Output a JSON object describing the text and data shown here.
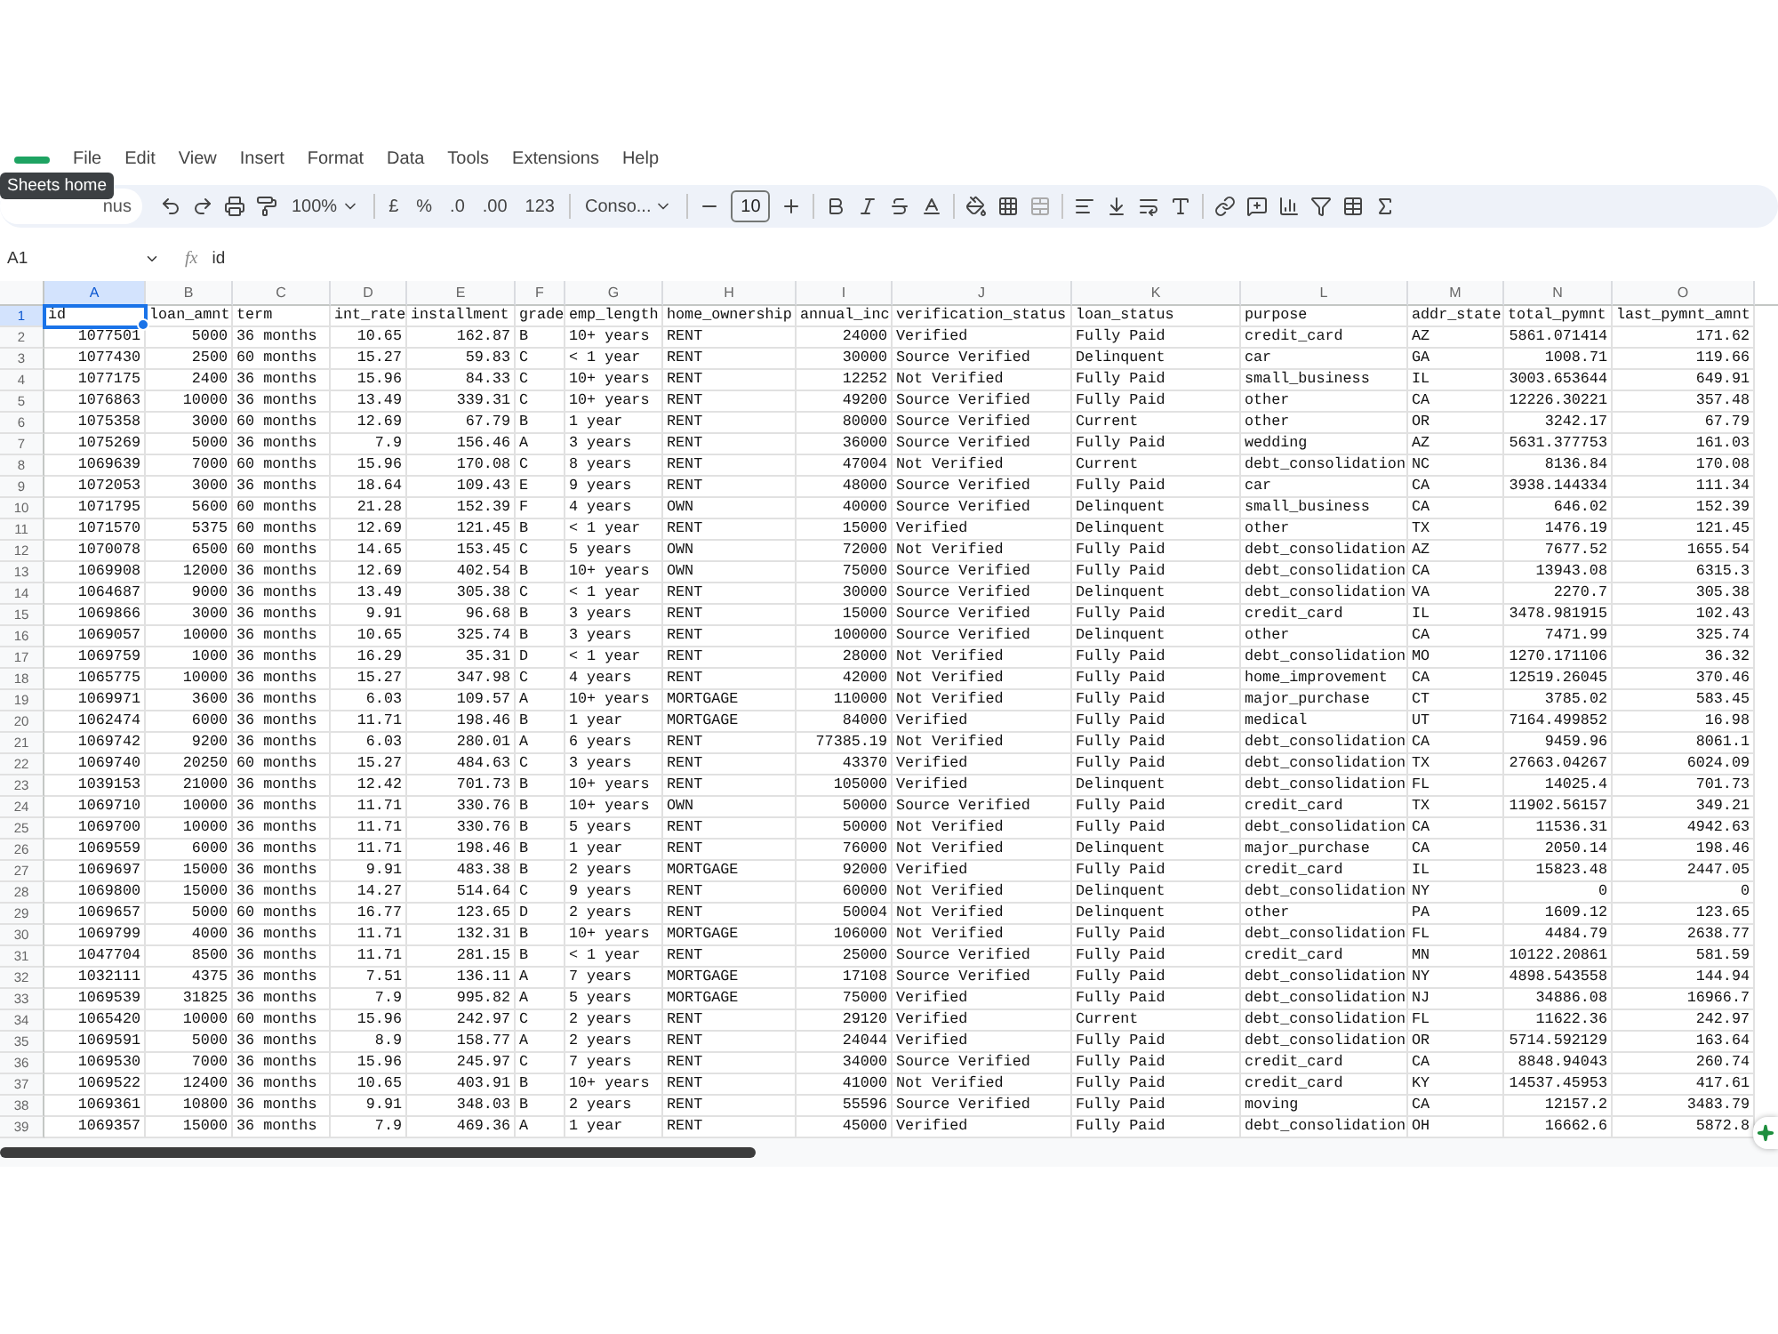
{
  "menu": [
    "File",
    "Edit",
    "View",
    "Insert",
    "Format",
    "Data",
    "Tools",
    "Extensions",
    "Help"
  ],
  "search": {
    "text": "nus"
  },
  "tooltip": "Sheets home",
  "toolbar": {
    "zoom": "100%",
    "currency": "£",
    "percent": "%",
    "decrease_decimals": ".0",
    "increase_decimals": ".00",
    "number_format": "123",
    "font": "Conso...",
    "font_size": "10"
  },
  "name_box": "A1",
  "formula_label": "fx",
  "formula": "id",
  "columns": [
    {
      "letter": "A",
      "numeric": true,
      "selected": true
    },
    {
      "letter": "B",
      "numeric": true,
      "selected": false
    },
    {
      "letter": "C",
      "numeric": false,
      "selected": false
    },
    {
      "letter": "D",
      "numeric": true,
      "selected": false
    },
    {
      "letter": "E",
      "numeric": true,
      "selected": false
    },
    {
      "letter": "F",
      "numeric": false,
      "selected": false
    },
    {
      "letter": "G",
      "numeric": false,
      "selected": false
    },
    {
      "letter": "H",
      "numeric": false,
      "selected": false
    },
    {
      "letter": "I",
      "numeric": true,
      "selected": false
    },
    {
      "letter": "J",
      "numeric": false,
      "selected": false
    },
    {
      "letter": "K",
      "numeric": false,
      "selected": false
    },
    {
      "letter": "L",
      "numeric": false,
      "selected": false
    },
    {
      "letter": "M",
      "numeric": false,
      "selected": false
    },
    {
      "letter": "N",
      "numeric": true,
      "selected": false
    },
    {
      "letter": "O",
      "numeric": true,
      "selected": false
    }
  ],
  "rows": [
    {
      "number": "1",
      "kind": "header",
      "selected": true,
      "cells": [
        "id",
        "loan_amnt",
        "term",
        "int_rate",
        "installment",
        "grade",
        "emp_length",
        "home_ownership",
        "annual_inc",
        "verification_status",
        "loan_status",
        "purpose",
        "addr_state",
        "total_pymnt",
        "last_pymnt_amnt"
      ]
    },
    {
      "number": "2",
      "kind": "data",
      "selected": false,
      "cells": [
        "1077501",
        "5000",
        "36 months",
        "10.65",
        "162.87",
        "B",
        "10+ years",
        "RENT",
        "24000",
        "Verified",
        "Fully Paid",
        "credit_card",
        "AZ",
        "5861.071414",
        "171.62"
      ]
    },
    {
      "number": "3",
      "kind": "data",
      "selected": false,
      "cells": [
        "1077430",
        "2500",
        "60 months",
        "15.27",
        "59.83",
        "C",
        "< 1 year",
        "RENT",
        "30000",
        "Source Verified",
        "Delinquent",
        "car",
        "GA",
        "1008.71",
        "119.66"
      ]
    },
    {
      "number": "4",
      "kind": "data",
      "selected": false,
      "cells": [
        "1077175",
        "2400",
        "36 months",
        "15.96",
        "84.33",
        "C",
        "10+ years",
        "RENT",
        "12252",
        "Not Verified",
        "Fully Paid",
        "small_business",
        "IL",
        "3003.653644",
        "649.91"
      ]
    },
    {
      "number": "5",
      "kind": "data",
      "selected": false,
      "cells": [
        "1076863",
        "10000",
        "36 months",
        "13.49",
        "339.31",
        "C",
        "10+ years",
        "RENT",
        "49200",
        "Source Verified",
        "Fully Paid",
        "other",
        "CA",
        "12226.30221",
        "357.48"
      ]
    },
    {
      "number": "6",
      "kind": "data",
      "selected": false,
      "cells": [
        "1075358",
        "3000",
        "60 months",
        "12.69",
        "67.79",
        "B",
        "1 year",
        "RENT",
        "80000",
        "Source Verified",
        "Current",
        "other",
        "OR",
        "3242.17",
        "67.79"
      ]
    },
    {
      "number": "7",
      "kind": "data",
      "selected": false,
      "cells": [
        "1075269",
        "5000",
        "36 months",
        "7.9",
        "156.46",
        "A",
        "3 years",
        "RENT",
        "36000",
        "Source Verified",
        "Fully Paid",
        "wedding",
        "AZ",
        "5631.377753",
        "161.03"
      ]
    },
    {
      "number": "8",
      "kind": "data",
      "selected": false,
      "cells": [
        "1069639",
        "7000",
        "60 months",
        "15.96",
        "170.08",
        "C",
        "8 years",
        "RENT",
        "47004",
        "Not Verified",
        "Current",
        "debt_consolidation",
        "NC",
        "8136.84",
        "170.08"
      ]
    },
    {
      "number": "9",
      "kind": "data",
      "selected": false,
      "cells": [
        "1072053",
        "3000",
        "36 months",
        "18.64",
        "109.43",
        "E",
        "9 years",
        "RENT",
        "48000",
        "Source Verified",
        "Fully Paid",
        "car",
        "CA",
        "3938.144334",
        "111.34"
      ]
    },
    {
      "number": "10",
      "kind": "data",
      "selected": false,
      "cells": [
        "1071795",
        "5600",
        "60 months",
        "21.28",
        "152.39",
        "F",
        "4 years",
        "OWN",
        "40000",
        "Source Verified",
        "Delinquent",
        "small_business",
        "CA",
        "646.02",
        "152.39"
      ]
    },
    {
      "number": "11",
      "kind": "data",
      "selected": false,
      "cells": [
        "1071570",
        "5375",
        "60 months",
        "12.69",
        "121.45",
        "B",
        "< 1 year",
        "RENT",
        "15000",
        "Verified",
        "Delinquent",
        "other",
        "TX",
        "1476.19",
        "121.45"
      ]
    },
    {
      "number": "12",
      "kind": "data",
      "selected": false,
      "cells": [
        "1070078",
        "6500",
        "60 months",
        "14.65",
        "153.45",
        "C",
        "5 years",
        "OWN",
        "72000",
        "Not Verified",
        "Fully Paid",
        "debt_consolidation",
        "AZ",
        "7677.52",
        "1655.54"
      ]
    },
    {
      "number": "13",
      "kind": "data",
      "selected": false,
      "cells": [
        "1069908",
        "12000",
        "36 months",
        "12.69",
        "402.54",
        "B",
        "10+ years",
        "OWN",
        "75000",
        "Source Verified",
        "Fully Paid",
        "debt_consolidation",
        "CA",
        "13943.08",
        "6315.3"
      ]
    },
    {
      "number": "14",
      "kind": "data",
      "selected": false,
      "cells": [
        "1064687",
        "9000",
        "36 months",
        "13.49",
        "305.38",
        "C",
        "< 1 year",
        "RENT",
        "30000",
        "Source Verified",
        "Delinquent",
        "debt_consolidation",
        "VA",
        "2270.7",
        "305.38"
      ]
    },
    {
      "number": "15",
      "kind": "data",
      "selected": false,
      "cells": [
        "1069866",
        "3000",
        "36 months",
        "9.91",
        "96.68",
        "B",
        "3 years",
        "RENT",
        "15000",
        "Source Verified",
        "Fully Paid",
        "credit_card",
        "IL",
        "3478.981915",
        "102.43"
      ]
    },
    {
      "number": "16",
      "kind": "data",
      "selected": false,
      "cells": [
        "1069057",
        "10000",
        "36 months",
        "10.65",
        "325.74",
        "B",
        "3 years",
        "RENT",
        "100000",
        "Source Verified",
        "Delinquent",
        "other",
        "CA",
        "7471.99",
        "325.74"
      ]
    },
    {
      "number": "17",
      "kind": "data",
      "selected": false,
      "cells": [
        "1069759",
        "1000",
        "36 months",
        "16.29",
        "35.31",
        "D",
        "< 1 year",
        "RENT",
        "28000",
        "Not Verified",
        "Fully Paid",
        "debt_consolidation",
        "MO",
        "1270.171106",
        "36.32"
      ]
    },
    {
      "number": "18",
      "kind": "data",
      "selected": false,
      "cells": [
        "1065775",
        "10000",
        "36 months",
        "15.27",
        "347.98",
        "C",
        "4 years",
        "RENT",
        "42000",
        "Not Verified",
        "Fully Paid",
        "home_improvement",
        "CA",
        "12519.26045",
        "370.46"
      ]
    },
    {
      "number": "19",
      "kind": "data",
      "selected": false,
      "cells": [
        "1069971",
        "3600",
        "36 months",
        "6.03",
        "109.57",
        "A",
        "10+ years",
        "MORTGAGE",
        "110000",
        "Not Verified",
        "Fully Paid",
        "major_purchase",
        "CT",
        "3785.02",
        "583.45"
      ]
    },
    {
      "number": "20",
      "kind": "data",
      "selected": false,
      "cells": [
        "1062474",
        "6000",
        "36 months",
        "11.71",
        "198.46",
        "B",
        "1 year",
        "MORTGAGE",
        "84000",
        "Verified",
        "Fully Paid",
        "medical",
        "UT",
        "7164.499852",
        "16.98"
      ]
    },
    {
      "number": "21",
      "kind": "data",
      "selected": false,
      "cells": [
        "1069742",
        "9200",
        "36 months",
        "6.03",
        "280.01",
        "A",
        "6 years",
        "RENT",
        "77385.19",
        "Not Verified",
        "Fully Paid",
        "debt_consolidation",
        "CA",
        "9459.96",
        "8061.1"
      ]
    },
    {
      "number": "22",
      "kind": "data",
      "selected": false,
      "cells": [
        "1069740",
        "20250",
        "60 months",
        "15.27",
        "484.63",
        "C",
        "3 years",
        "RENT",
        "43370",
        "Verified",
        "Fully Paid",
        "debt_consolidation",
        "TX",
        "27663.04267",
        "6024.09"
      ]
    },
    {
      "number": "23",
      "kind": "data",
      "selected": false,
      "cells": [
        "1039153",
        "21000",
        "36 months",
        "12.42",
        "701.73",
        "B",
        "10+ years",
        "RENT",
        "105000",
        "Verified",
        "Delinquent",
        "debt_consolidation",
        "FL",
        "14025.4",
        "701.73"
      ]
    },
    {
      "number": "24",
      "kind": "data",
      "selected": false,
      "cells": [
        "1069710",
        "10000",
        "36 months",
        "11.71",
        "330.76",
        "B",
        "10+ years",
        "OWN",
        "50000",
        "Source Verified",
        "Fully Paid",
        "credit_card",
        "TX",
        "11902.56157",
        "349.21"
      ]
    },
    {
      "number": "25",
      "kind": "data",
      "selected": false,
      "cells": [
        "1069700",
        "10000",
        "36 months",
        "11.71",
        "330.76",
        "B",
        "5 years",
        "RENT",
        "50000",
        "Not Verified",
        "Fully Paid",
        "debt_consolidation",
        "CA",
        "11536.31",
        "4942.63"
      ]
    },
    {
      "number": "26",
      "kind": "data",
      "selected": false,
      "cells": [
        "1069559",
        "6000",
        "36 months",
        "11.71",
        "198.46",
        "B",
        "1 year",
        "RENT",
        "76000",
        "Not Verified",
        "Delinquent",
        "major_purchase",
        "CA",
        "2050.14",
        "198.46"
      ]
    },
    {
      "number": "27",
      "kind": "data",
      "selected": false,
      "cells": [
        "1069697",
        "15000",
        "36 months",
        "9.91",
        "483.38",
        "B",
        "2 years",
        "MORTGAGE",
        "92000",
        "Verified",
        "Fully Paid",
        "credit_card",
        "IL",
        "15823.48",
        "2447.05"
      ]
    },
    {
      "number": "28",
      "kind": "data",
      "selected": false,
      "cells": [
        "1069800",
        "15000",
        "36 months",
        "14.27",
        "514.64",
        "C",
        "9 years",
        "RENT",
        "60000",
        "Not Verified",
        "Delinquent",
        "debt_consolidation",
        "NY",
        "0",
        "0"
      ]
    },
    {
      "number": "29",
      "kind": "data",
      "selected": false,
      "cells": [
        "1069657",
        "5000",
        "60 months",
        "16.77",
        "123.65",
        "D",
        "2 years",
        "RENT",
        "50004",
        "Not Verified",
        "Delinquent",
        "other",
        "PA",
        "1609.12",
        "123.65"
      ]
    },
    {
      "number": "30",
      "kind": "data",
      "selected": false,
      "cells": [
        "1069799",
        "4000",
        "36 months",
        "11.71",
        "132.31",
        "B",
        "10+ years",
        "MORTGAGE",
        "106000",
        "Not Verified",
        "Fully Paid",
        "debt_consolidation",
        "FL",
        "4484.79",
        "2638.77"
      ]
    },
    {
      "number": "31",
      "kind": "data",
      "selected": false,
      "cells": [
        "1047704",
        "8500",
        "36 months",
        "11.71",
        "281.15",
        "B",
        "< 1 year",
        "RENT",
        "25000",
        "Source Verified",
        "Fully Paid",
        "credit_card",
        "MN",
        "10122.20861",
        "581.59"
      ]
    },
    {
      "number": "32",
      "kind": "data",
      "selected": false,
      "cells": [
        "1032111",
        "4375",
        "36 months",
        "7.51",
        "136.11",
        "A",
        "7 years",
        "MORTGAGE",
        "17108",
        "Source Verified",
        "Fully Paid",
        "debt_consolidation",
        "NY",
        "4898.543558",
        "144.94"
      ]
    },
    {
      "number": "33",
      "kind": "data",
      "selected": false,
      "cells": [
        "1069539",
        "31825",
        "36 months",
        "7.9",
        "995.82",
        "A",
        "5 years",
        "MORTGAGE",
        "75000",
        "Verified",
        "Fully Paid",
        "debt_consolidation",
        "NJ",
        "34886.08",
        "16966.7"
      ]
    },
    {
      "number": "34",
      "kind": "data",
      "selected": false,
      "cells": [
        "1065420",
        "10000",
        "60 months",
        "15.96",
        "242.97",
        "C",
        "2 years",
        "RENT",
        "29120",
        "Verified",
        "Current",
        "debt_consolidation",
        "FL",
        "11622.36",
        "242.97"
      ]
    },
    {
      "number": "35",
      "kind": "data",
      "selected": false,
      "cells": [
        "1069591",
        "5000",
        "36 months",
        "8.9",
        "158.77",
        "A",
        "2 years",
        "RENT",
        "24044",
        "Verified",
        "Fully Paid",
        "debt_consolidation",
        "OR",
        "5714.592129",
        "163.64"
      ]
    },
    {
      "number": "36",
      "kind": "data",
      "selected": false,
      "cells": [
        "1069530",
        "7000",
        "36 months",
        "15.96",
        "245.97",
        "C",
        "7 years",
        "RENT",
        "34000",
        "Source Verified",
        "Fully Paid",
        "credit_card",
        "CA",
        "8848.94043",
        "260.74"
      ]
    },
    {
      "number": "37",
      "kind": "data",
      "selected": false,
      "cells": [
        "1069522",
        "12400",
        "36 months",
        "10.65",
        "403.91",
        "B",
        "10+ years",
        "RENT",
        "41000",
        "Not Verified",
        "Fully Paid",
        "credit_card",
        "KY",
        "14537.45953",
        "417.61"
      ]
    },
    {
      "number": "38",
      "kind": "data",
      "selected": false,
      "cells": [
        "1069361",
        "10800",
        "36 months",
        "9.91",
        "348.03",
        "B",
        "2 years",
        "RENT",
        "55596",
        "Source Verified",
        "Fully Paid",
        "moving",
        "CA",
        "12157.2",
        "3483.79"
      ]
    },
    {
      "number": "39",
      "kind": "data",
      "selected": false,
      "cells": [
        "1069357",
        "15000",
        "36 months",
        "7.9",
        "469.36",
        "A",
        "1 year",
        "RENT",
        "45000",
        "Verified",
        "Fully Paid",
        "debt_consolidation",
        "OH",
        "16662.6",
        "5872.8"
      ]
    }
  ]
}
